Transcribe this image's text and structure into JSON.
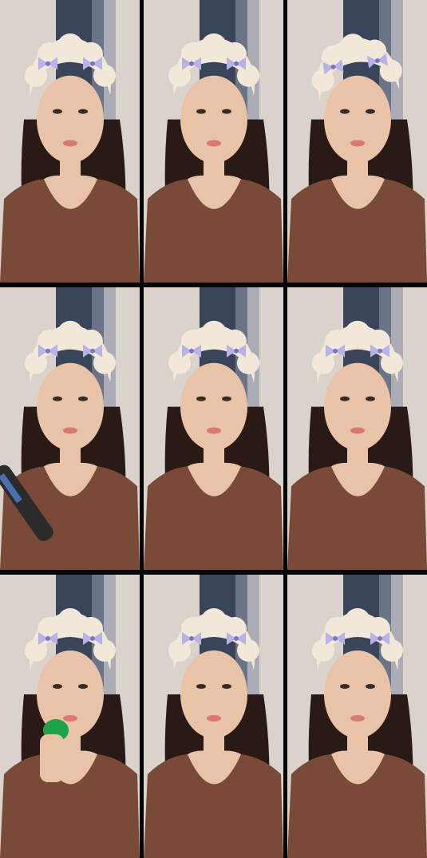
{
  "tiles": [
    {
      "pose": "pout",
      "prop": "none",
      "headband": "center"
    },
    {
      "pose": "talking",
      "prop": "none",
      "headband": "center"
    },
    {
      "pose": "looking-down",
      "prop": "none",
      "headband": "tilted"
    },
    {
      "pose": "holding-microphone",
      "prop": "microphone",
      "headband": "center"
    },
    {
      "pose": "talking",
      "prop": "none",
      "headband": "center"
    },
    {
      "pose": "neutral",
      "prop": "none",
      "headband": "center"
    },
    {
      "pose": "drinking",
      "prop": "green-bottle",
      "headband": "center"
    },
    {
      "pose": "close-up",
      "prop": "none",
      "headband": "center"
    },
    {
      "pose": "neutral",
      "prop": "none",
      "headband": "center"
    }
  ],
  "colors": {
    "wall": "#d9d3cc",
    "curtain": "#1d2a44",
    "skin": "#e9c3a8",
    "hair": "#2a1a16",
    "shirt": "#7a4a38",
    "headband": "#f1e8da",
    "bow": "#b8b2e6"
  }
}
